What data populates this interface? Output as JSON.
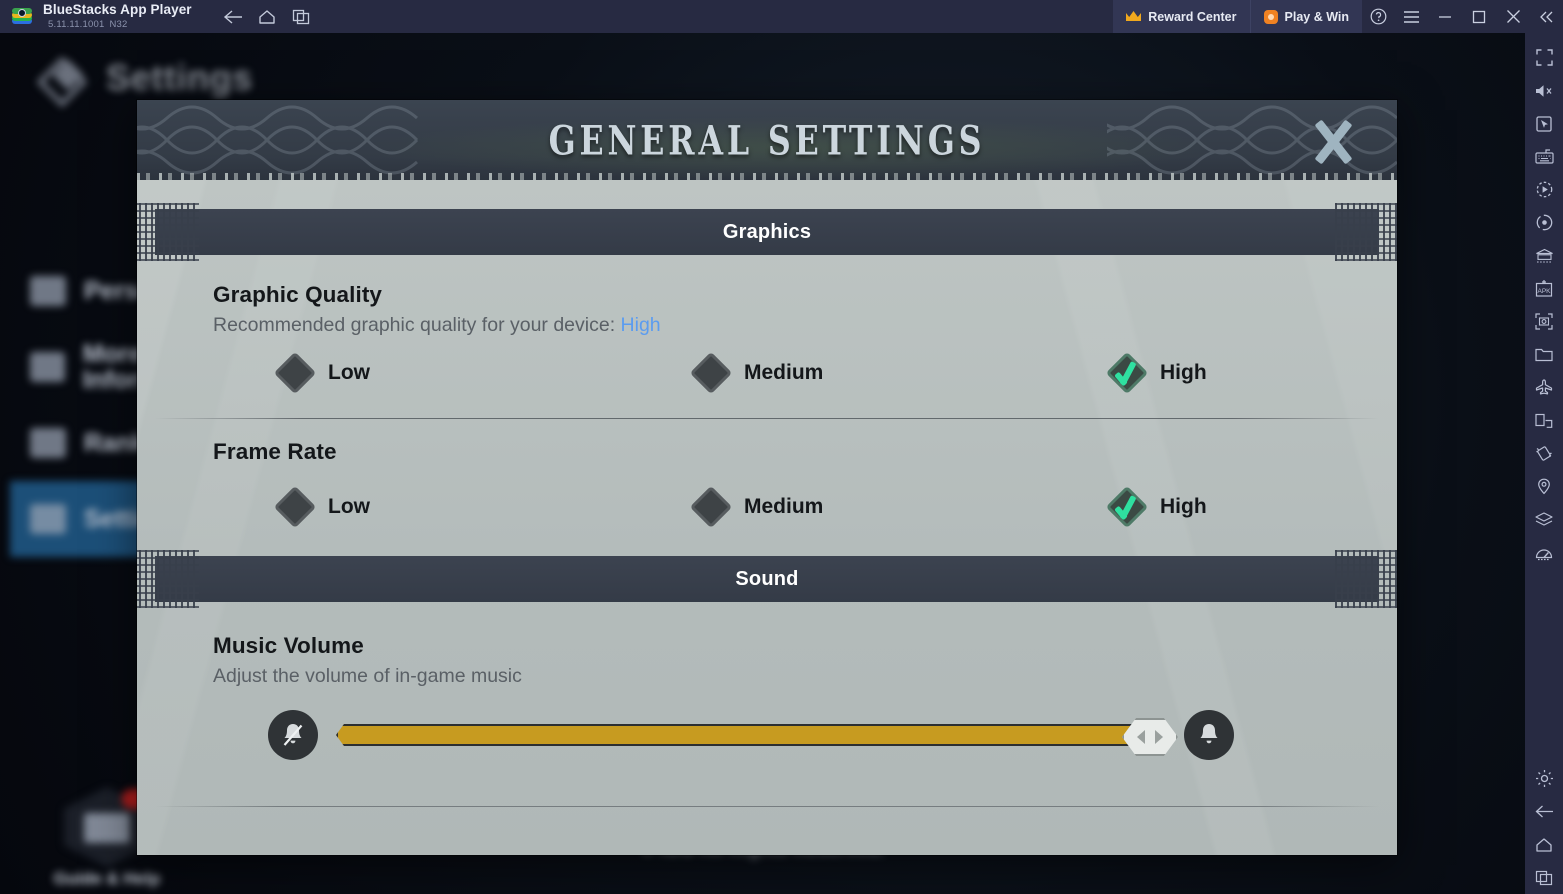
{
  "window": {
    "app_name": "BlueStacks App Player",
    "version": "5.11.11.1001",
    "build": "N32",
    "nav": [
      {
        "name": "back",
        "label": "Back"
      },
      {
        "name": "home",
        "label": "Home"
      },
      {
        "name": "multi-instance",
        "label": "Multi-instance"
      }
    ],
    "reward_center_label": "Reward Center",
    "play_and_win_label": "Play & Win",
    "help_label": "?",
    "menu_label": "Menu",
    "minimize_label": "Minimize",
    "maximize_label": "Maximize",
    "close_label": "Close",
    "collapse_label": "Collapse"
  },
  "sidebar": {
    "items": [
      {
        "name": "fullscreen-icon",
        "label": "Full screen"
      },
      {
        "name": "mute-icon",
        "label": "Mute"
      },
      {
        "name": "cursor-icon",
        "label": "Game controls"
      },
      {
        "name": "keyboard-icon",
        "label": "Keymapping"
      },
      {
        "name": "macro-record-icon",
        "label": "Macro recorder"
      },
      {
        "name": "record-icon",
        "label": "Record screen"
      },
      {
        "name": "multi-instance-sync-icon",
        "label": "Sync operations"
      },
      {
        "name": "install-apk-icon",
        "label": "Install APK"
      },
      {
        "name": "screenshot-icon",
        "label": "Screenshot"
      },
      {
        "name": "media-folder-icon",
        "label": "Media manager"
      },
      {
        "name": "airplane-icon",
        "label": "Eco mode"
      },
      {
        "name": "rotate-screen-icon",
        "label": "Rotate"
      },
      {
        "name": "shake-icon",
        "label": "Shake"
      },
      {
        "name": "location-icon",
        "label": "Location"
      },
      {
        "name": "layers-icon",
        "label": "Layers"
      },
      {
        "name": "performance-icon",
        "label": "Performance"
      },
      {
        "name": "settings-gear-icon",
        "label": "Settings"
      },
      {
        "name": "back-arrow-icon",
        "label": "Back"
      },
      {
        "name": "home-icon",
        "label": "Home"
      },
      {
        "name": "recents-icon",
        "label": "Recent apps"
      }
    ]
  },
  "game_background": {
    "page_title": "Settings",
    "menu_items": [
      {
        "label": "Personal info",
        "selected": false
      },
      {
        "label": "More Information",
        "selected": false
      },
      {
        "label": "Rank",
        "selected": false
      },
      {
        "label": "Settings",
        "selected": true
      }
    ],
    "guide_label": "Guide & Help",
    "copyright": "© IGG All Rights Reserved."
  },
  "dialog": {
    "title": "GENERAL SETTINGS",
    "close_label": "Close",
    "sections": [
      {
        "header": "Graphics",
        "groups": [
          {
            "title": "Graphic Quality",
            "subtitle_prefix": "Recommended graphic quality for your device: ",
            "subtitle_value": "High",
            "options": [
              {
                "label": "Low",
                "selected": false
              },
              {
                "label": "Medium",
                "selected": false
              },
              {
                "label": "High",
                "selected": true
              }
            ]
          },
          {
            "title": "Frame Rate",
            "options": [
              {
                "label": "Low",
                "selected": false
              },
              {
                "label": "Medium",
                "selected": false
              },
              {
                "label": "High",
                "selected": true
              }
            ]
          }
        ]
      },
      {
        "header": "Sound",
        "groups": [
          {
            "title": "Music Volume",
            "subtitle": "Adjust the volume of in-game music",
            "slider": {
              "min_icon": "bell-muted-icon",
              "max_icon": "bell-icon",
              "value_percent": 95
            }
          }
        ]
      }
    ]
  },
  "colors": {
    "accent_blue": "#5b9cf0",
    "check_green": "#2fe0a0",
    "slider_gold": "#c79b20",
    "titlebar": "#272a42",
    "panel": "#b7bfbe"
  }
}
